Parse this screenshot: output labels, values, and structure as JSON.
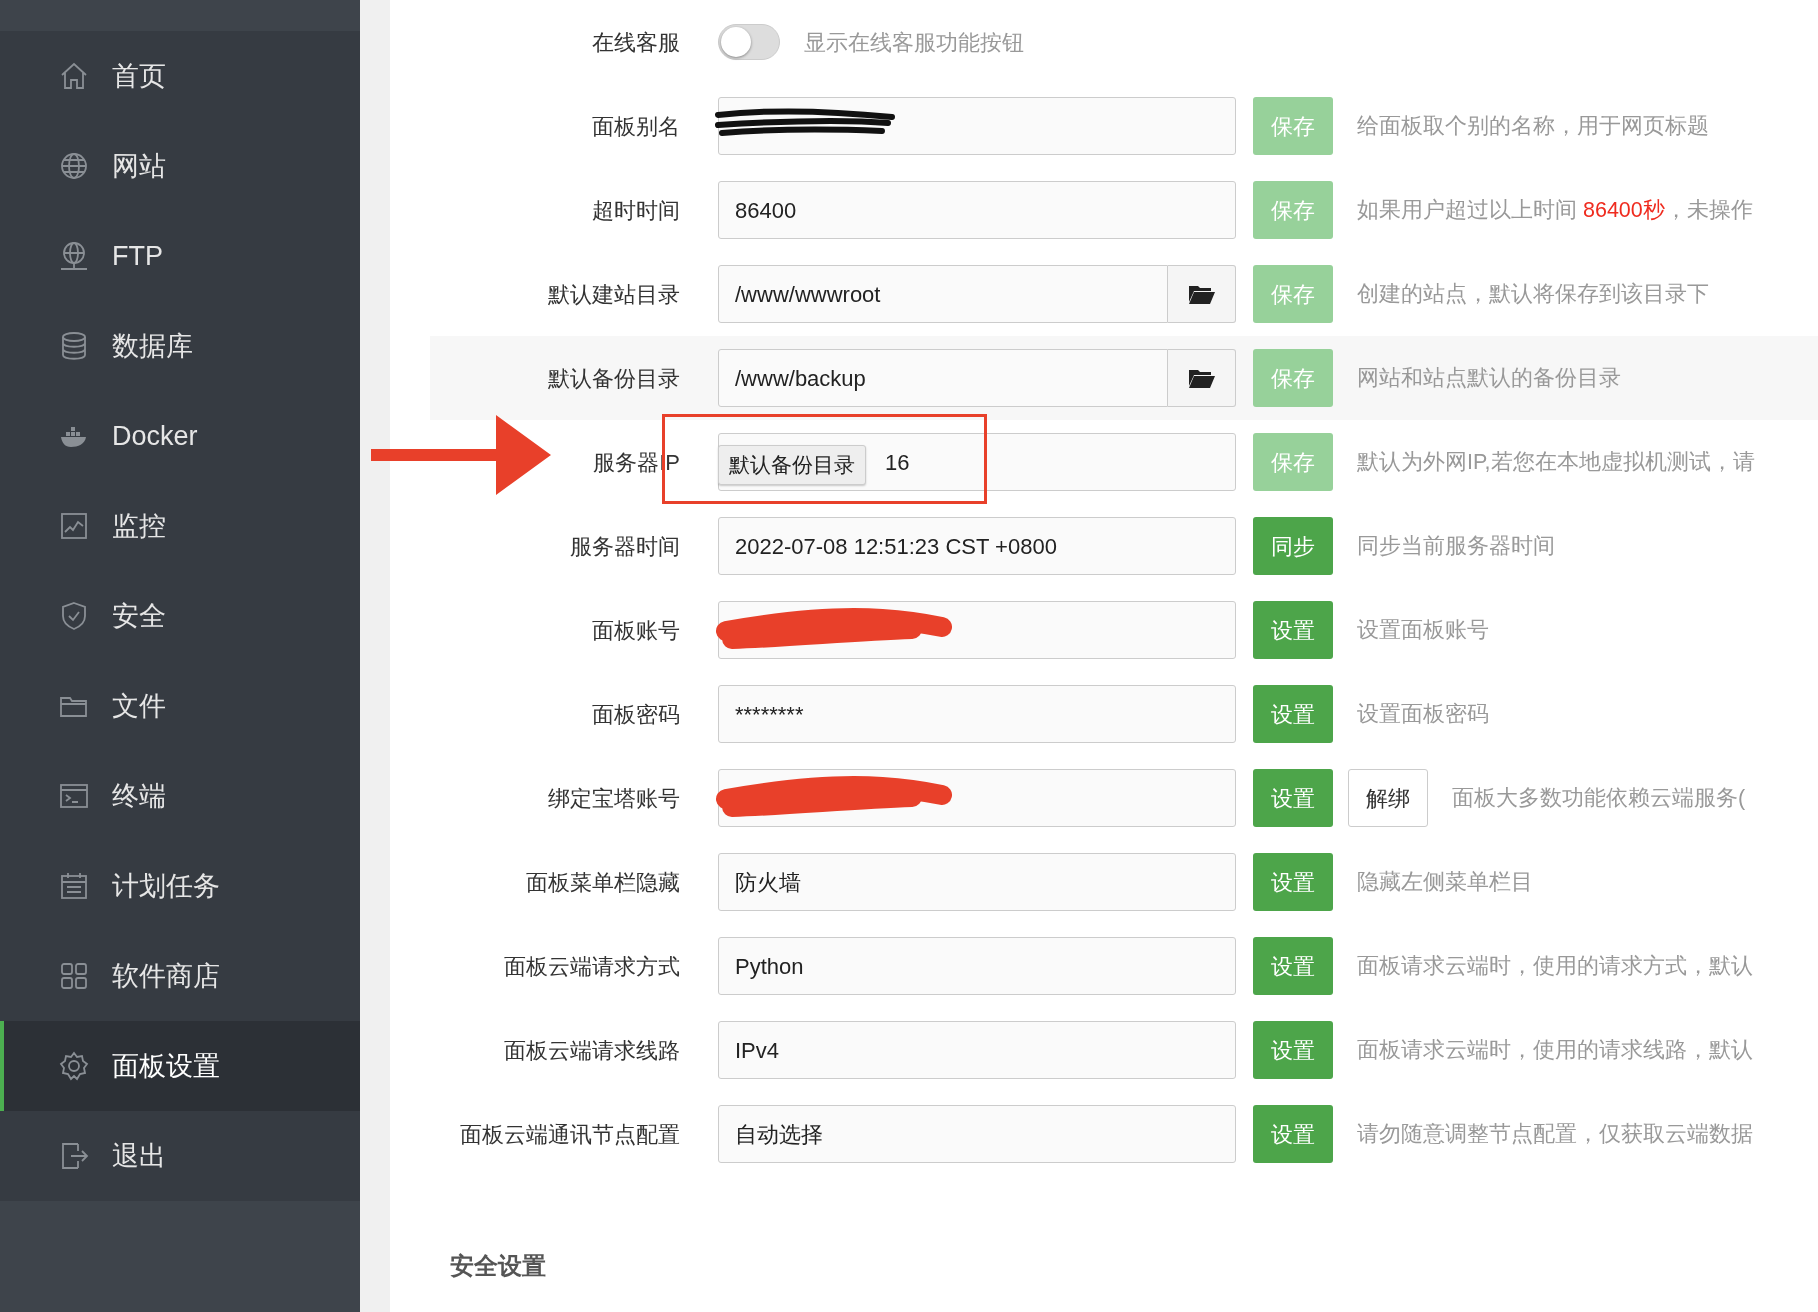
{
  "sidebar": {
    "items": [
      {
        "label": "首页",
        "selected": false
      },
      {
        "label": "网站",
        "selected": false
      },
      {
        "label": "FTP",
        "selected": false
      },
      {
        "label": "数据库",
        "selected": false
      },
      {
        "label": "Docker",
        "selected": false
      },
      {
        "label": "监控",
        "selected": false
      },
      {
        "label": "安全",
        "selected": false
      },
      {
        "label": "文件",
        "selected": false
      },
      {
        "label": "终端",
        "selected": false
      },
      {
        "label": "计划任务",
        "selected": false
      },
      {
        "label": "软件商店",
        "selected": false
      },
      {
        "label": "面板设置",
        "selected": true
      },
      {
        "label": "退出",
        "selected": false
      }
    ]
  },
  "settings": [
    {
      "kind": "toggle",
      "label": "在线客服",
      "on": false,
      "description": "显示在线客服功能按钮"
    },
    {
      "kind": "field",
      "label": "面板别名",
      "redaction": {
        "color": "#111111"
      },
      "button": {
        "label": "保存",
        "disabled": true
      },
      "description": "给面板取个别的名称，用于网页标题"
    },
    {
      "kind": "field",
      "label": "超时时间",
      "value": "86400",
      "button": {
        "label": "保存",
        "disabled": true
      },
      "description_parts": [
        {
          "text": "如果用户超过以上时间 ",
          "highlight": false
        },
        {
          "text": "86400秒",
          "highlight": true
        },
        {
          "text": "，未操作",
          "highlight": false
        }
      ]
    },
    {
      "kind": "field",
      "label": "默认建站目录",
      "value": "/www/wwwroot",
      "browse": true,
      "button": {
        "label": "保存",
        "disabled": true
      },
      "description": "创建的站点，默认将保存到该目录下"
    },
    {
      "kind": "field",
      "label": "默认备份目录",
      "value": "/www/backup",
      "browse": true,
      "hovered": true,
      "button": {
        "label": "保存",
        "disabled": true
      },
      "description": "网站和站点默认的备份目录"
    },
    {
      "kind": "field",
      "label": "服务器IP",
      "value": "16",
      "tooltip": "默认备份目录",
      "button": {
        "label": "保存",
        "disabled": true
      },
      "description": "默认为外网IP,若您在本地虚拟机测试，请"
    },
    {
      "kind": "field",
      "label": "服务器时间",
      "value": "2022-07-08 12:51:23 CST +0800",
      "button": {
        "label": "同步",
        "disabled": false
      },
      "description": "同步当前服务器时间"
    },
    {
      "kind": "field",
      "label": "面板账号",
      "redaction": {
        "color": "#e8402a"
      },
      "button": {
        "label": "设置",
        "disabled": false
      },
      "description": "设置面板账号"
    },
    {
      "kind": "field",
      "label": "面板密码",
      "value": "********",
      "button": {
        "label": "设置",
        "disabled": false
      },
      "description": "设置面板密码"
    },
    {
      "kind": "field",
      "label": "绑定宝塔账号",
      "redaction": {
        "color": "#e8402a"
      },
      "button": {
        "label": "设置",
        "disabled": false
      },
      "extra_button": "解绑",
      "description": "面板大多数功能依赖云端服务("
    },
    {
      "kind": "field",
      "label": "面板菜单栏隐藏",
      "value": "防火墙",
      "button": {
        "label": "设置",
        "disabled": false
      },
      "description": "隐藏左侧菜单栏目"
    },
    {
      "kind": "field",
      "label": "面板云端请求方式",
      "value": "Python",
      "button": {
        "label": "设置",
        "disabled": false
      },
      "description": "面板请求云端时，使用的请求方式，默认"
    },
    {
      "kind": "field",
      "label": "面板云端请求线路",
      "value": "IPv4",
      "button": {
        "label": "设置",
        "disabled": false
      },
      "description": "面板请求云端时，使用的请求线路，默认"
    },
    {
      "kind": "field",
      "label": "面板云端通讯节点配置",
      "value": "自动选择",
      "button": {
        "label": "设置",
        "disabled": false
      },
      "description": "请勿随意调整节点配置，仅获取云端数据"
    }
  ],
  "section_heading": "安全设置",
  "annotation": {
    "arrow": true,
    "highlight_box": true
  }
}
